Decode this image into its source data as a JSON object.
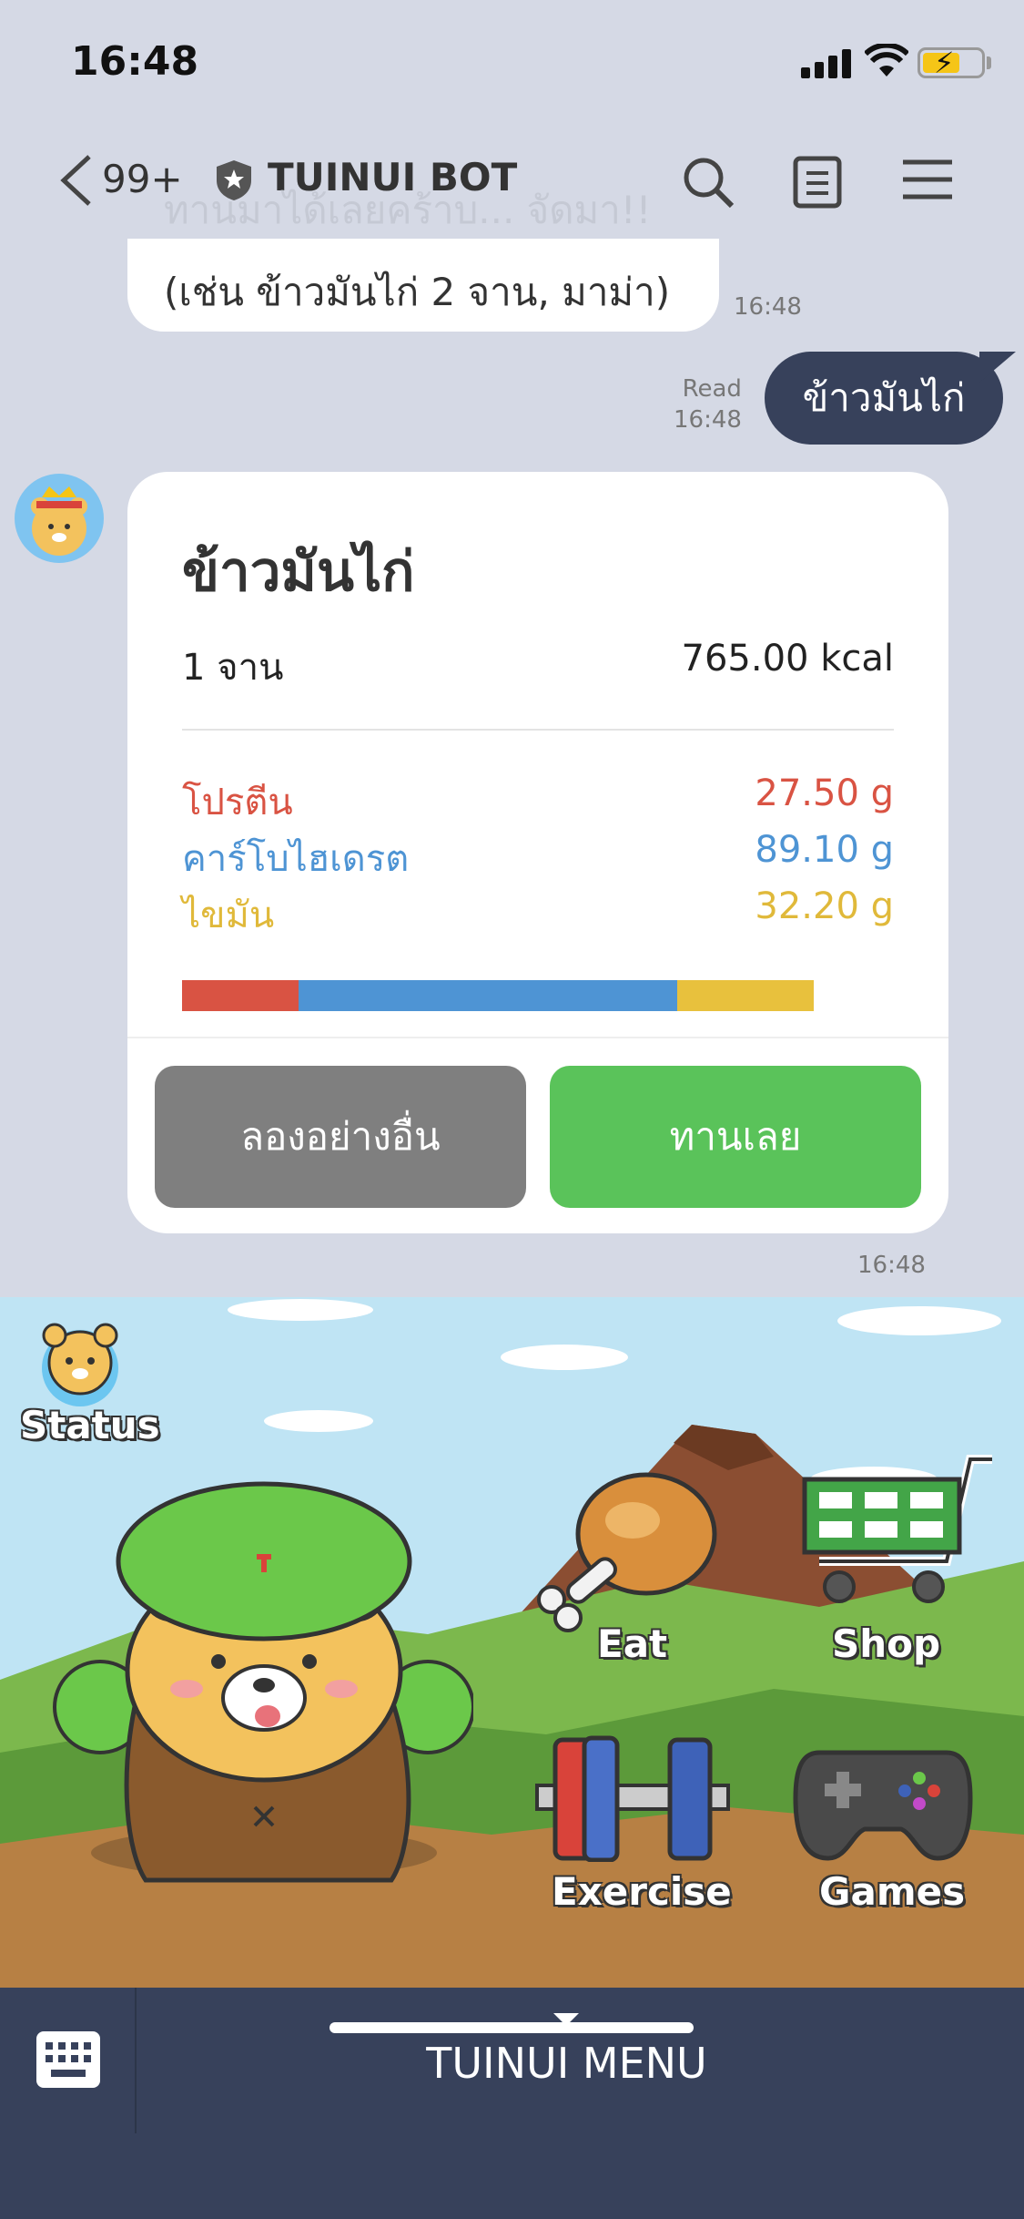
{
  "status_bar": {
    "time": "16:48"
  },
  "header": {
    "unread_count": "99+",
    "title": "TUINUI BOT",
    "back_icon": "chevron-left-icon",
    "shield_icon": "shield-star-icon",
    "search_icon": "search-icon",
    "notes_icon": "notes-icon",
    "menu_icon": "hamburger-icon"
  },
  "chat": {
    "bot_message_faded": "ทานมาได้เลยคร้าบ... จัดมา!!",
    "bot_message_visible": "(เช่น ข้าวมันไก่ 2 จาน, มาม่า)",
    "bot_message_time": "16:48",
    "user_message": "ข้าวมันไก่",
    "read_status": "Read",
    "user_message_time": "16:48",
    "card_time": "16:48"
  },
  "food_card": {
    "title": "ข้าวมันไก่",
    "serving": "1 จาน",
    "calories": "765.00 kcal",
    "nutrients": [
      {
        "label": "โปรตีน",
        "value": "27.50 g",
        "color": "#d95343",
        "grams": 27.5
      },
      {
        "label": "คาร์โบไฮเดรต",
        "value": "89.10 g",
        "color": "#4e94d4",
        "grams": 89.1
      },
      {
        "label": "ไขมัน",
        "value": "32.20 g",
        "color": "#e8c13d",
        "grams": 32.2
      }
    ],
    "buttons": {
      "try_other": "ลองอย่างอื่น",
      "eat_now": "ทานเลย"
    }
  },
  "rich_menu": {
    "status_label": "Status",
    "eat_label": "Eat",
    "shop_label": "Shop",
    "exercise_label": "Exercise",
    "games_label": "Games"
  },
  "bottom_bar": {
    "keyboard_icon": "keyboard-icon",
    "menu_label": "TUINUI MENU"
  }
}
